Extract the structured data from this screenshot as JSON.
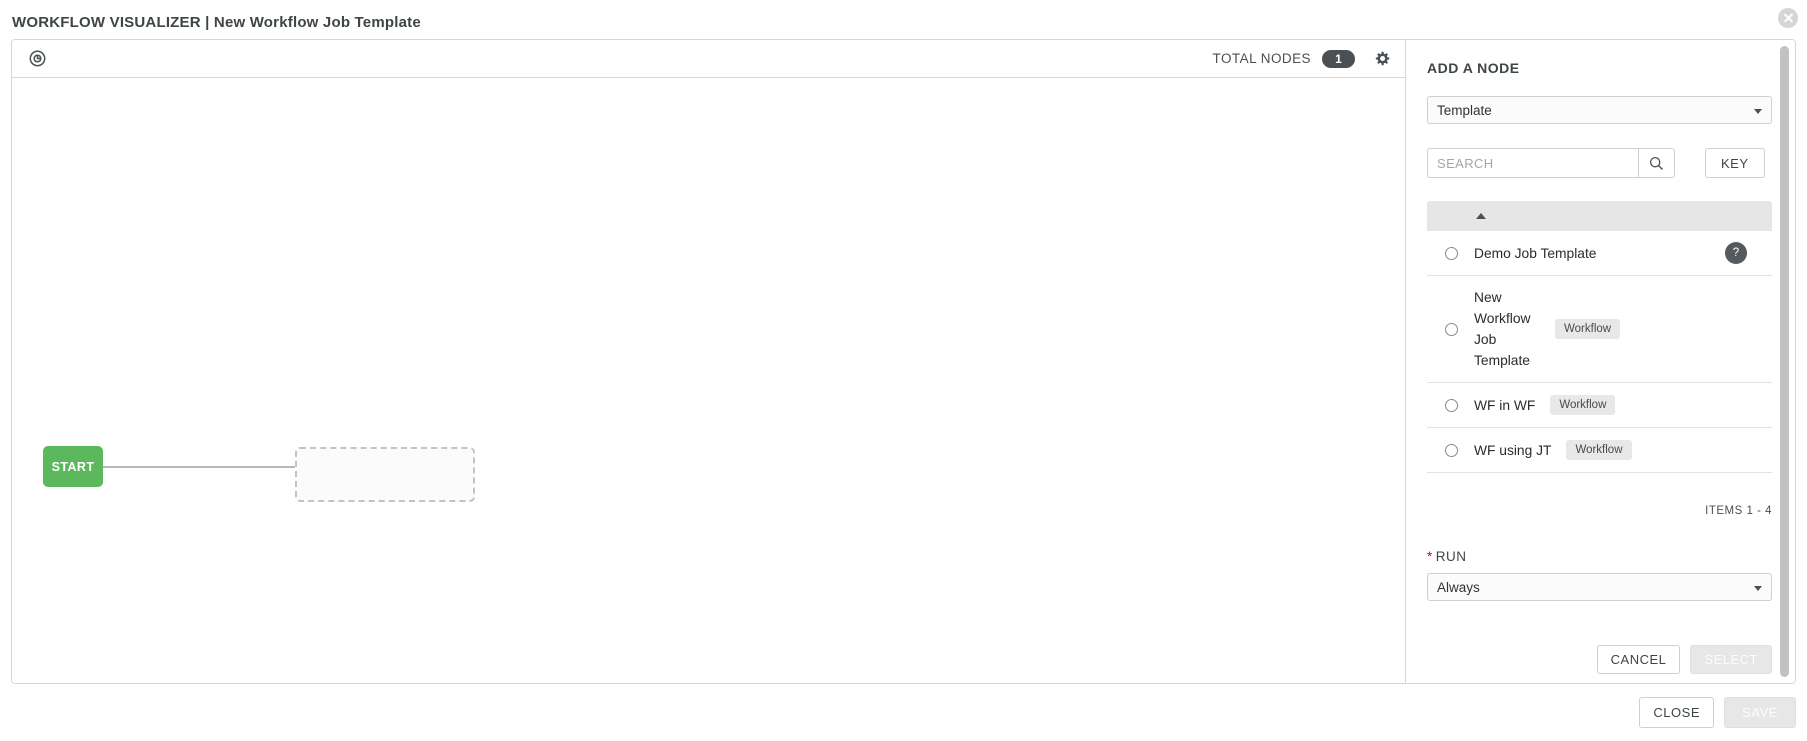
{
  "header": {
    "title": "WORKFLOW VISUALIZER | New Workflow Job Template",
    "close_icon": "close-circle-icon"
  },
  "canvas": {
    "toolbar": {
      "compass_icon": "compass-icon",
      "total_nodes_label": "TOTAL NODES",
      "total_nodes_count": "1",
      "settings_icon": "gear-icon"
    },
    "start_node_label": "START",
    "placeholder_node_label": ""
  },
  "panel": {
    "heading": "ADD A NODE",
    "node_type": {
      "value": "Template",
      "caret_icon": "chevron-down-icon"
    },
    "search": {
      "placeholder": "SEARCH",
      "value": "",
      "search_icon": "search-icon",
      "key_label": "KEY"
    },
    "list": {
      "sort_icon": "sort-ascending-icon",
      "rows": [
        {
          "name": "Demo Job Template",
          "tag": "",
          "badge": "?"
        },
        {
          "name": "New Workflow Job Template",
          "tag": "Workflow",
          "badge": ""
        },
        {
          "name": "WF in WF",
          "tag": "Workflow",
          "badge": ""
        },
        {
          "name": "WF using JT",
          "tag": "Workflow",
          "badge": ""
        }
      ],
      "items_count": "ITEMS  1 - 4"
    },
    "run": {
      "required_marker": "*",
      "label": "RUN",
      "value": "Always",
      "caret_icon": "chevron-down-icon"
    },
    "actions": {
      "cancel_label": "CANCEL",
      "select_label": "SELECT"
    }
  },
  "footer": {
    "close_label": "CLOSE",
    "save_label": "SAVE"
  },
  "colors": {
    "start_node_green": "#5cb85c",
    "badge_dark": "#4a5053",
    "required_red": "#cc0000"
  }
}
